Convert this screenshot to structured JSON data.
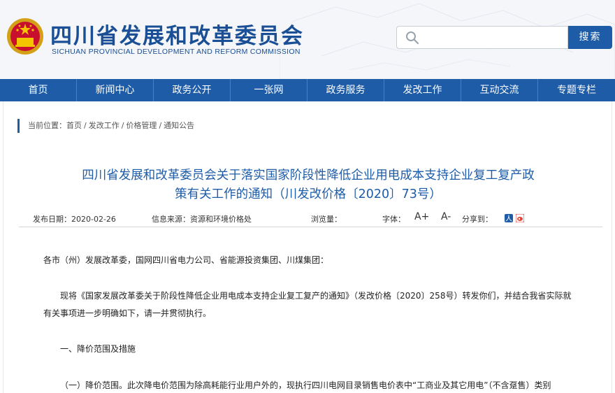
{
  "header": {
    "title_cn": "四川省发展和改革委员会",
    "title_en": "SICHUAN PROVINCIAL DEVELOPMENT AND REFORM COMMISSION",
    "search_placeholder": "",
    "search_button": "搜索",
    "logo_icon": "national-emblem-icon"
  },
  "nav": {
    "items": [
      "首页",
      "新闻中心",
      "政务公开",
      "一张网",
      "政务服务",
      "发改工作",
      "互动交流",
      "专题专栏"
    ]
  },
  "breadcrumb": {
    "prefix": "当前位置：",
    "items": [
      "首页",
      "发改工作",
      "价格管理",
      "通知公告"
    ]
  },
  "article": {
    "title_line1": "四川省发展和改革委员会关于落实国家阶段性降低企业用电成本支持企业复工复产政",
    "title_line2": "策有关工作的通知（川发改价格〔2020〕73号）",
    "meta": {
      "date_label": "发布日期：",
      "date": "2020-02-26",
      "source_label": "信息来源：",
      "source": "资源和环境价格处",
      "views_label": "浏览量：",
      "font_label": "字体：",
      "font_increase": "A+",
      "font_decrease": "A-",
      "share_label": "分享到："
    },
    "paragraphs": [
      "各市（州）发展改革委，国网四川省电力公司、省能源投资集团、川煤集团：",
      "现将《国家发展改革委关于阶段性降低企业用电成本支持企业复工复产的通知》（发改价格〔2020〕258号）转发你们，并结合我省实际就",
      "有关事项进一步明确如下，请一并贯彻执行。",
      "一、降价范围及措施",
      "（一）降价范围。此次降电价范围为除高耗能行业用户外的，现执行四川电网目录销售电价表中“工商业及其它用电”（不含趸售）类别"
    ]
  },
  "colors": {
    "brand_blue": "#1e5ca8",
    "header_bg": "#f4f6f9"
  }
}
